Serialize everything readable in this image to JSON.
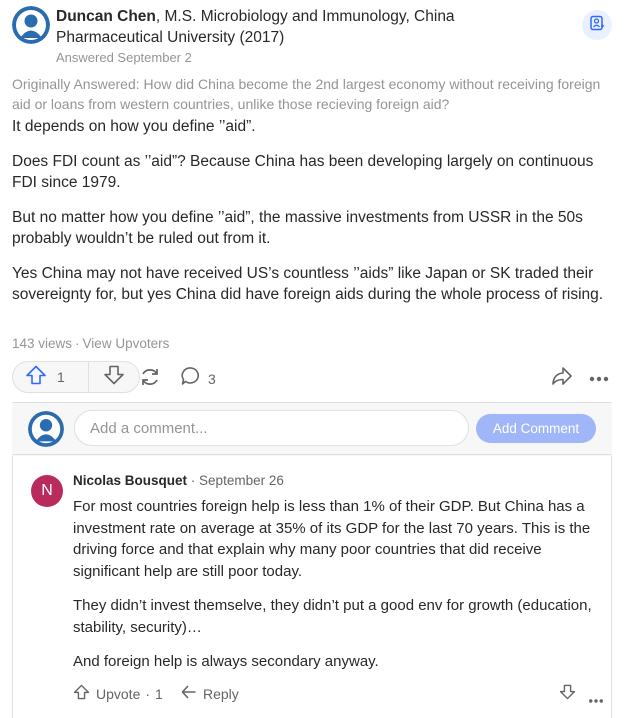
{
  "answer": {
    "author_name": "Duncan Chen",
    "credential": ", M.S. Microbiology and Immunology, China Pharmaceutical University (2017)",
    "answered_date": "Answered September 2",
    "originally_answered": "Originally Answered: How did China become the 2nd largest economy without receiving foreign aid or loans from western countries, unlike those recieving foreign aid?",
    "paragraphs": [
      "It depends on how you define ’’aid”.",
      "Does FDI count as ’’aid”? Because China has been developing largely on continuous FDI since 1979.",
      "But no matter how you define ’’aid”, the massive investments from USSR in the 50s probably wouldn’t be ruled out from it.",
      "Yes China may not have received US’s countless ’’aids” like Japan or SK traded their sovereignty for, but yes China did have foreign aids during the whole process of rising."
    ],
    "views": "143 views",
    "view_upvoters": "View Upvoters",
    "upvote_count": "1",
    "comment_count": "3"
  },
  "comment_input": {
    "placeholder": "Add a comment...",
    "button_label": "Add Comment"
  },
  "comment": {
    "avatar_letter": "N",
    "author": "Nicolas Bousquet",
    "date": "September 26",
    "paragraphs": [
      "For most countries foreign help is less than 1% of their GDP. But China has a investment rate on average at 35% of its GDP for the last 70 years. This is the driving force and that explain why many poor countries that did receive significant help are still poor today.",
      "They didn’t invest themselve, they didn’t put a good env for growth (education, stability, security)…",
      "And foreign help is always secondary anyway."
    ],
    "upvote_label": "Upvote",
    "upvote_count": "1",
    "reply_label": "Reply"
  },
  "colors": {
    "accent": "#2e69ff",
    "comment_avatar": "#b92b5d",
    "add_button": "#a1b6f8"
  },
  "icons": [
    "profile-avatar",
    "follow-icon",
    "upvote-icon",
    "downvote-icon",
    "share-icon",
    "comment-icon",
    "forward-icon",
    "more-icon",
    "reply-icon"
  ]
}
